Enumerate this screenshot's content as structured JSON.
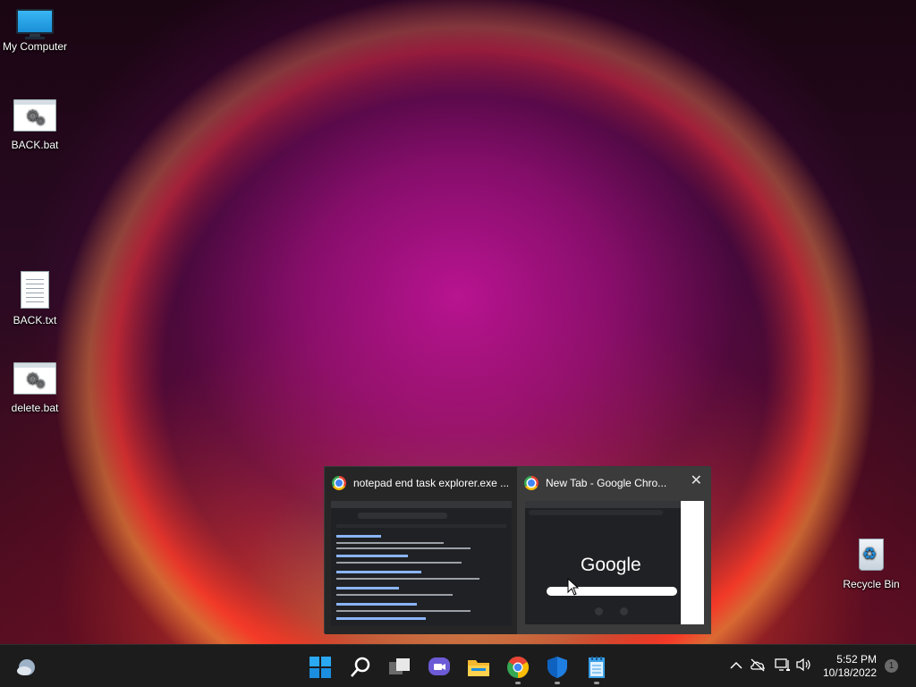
{
  "desktop": {
    "icons": [
      {
        "label": "My Computer"
      },
      {
        "label": "BACK.bat"
      },
      {
        "label": "BACK.txt"
      },
      {
        "label": "delete.bat"
      },
      {
        "label": "Recycle Bin"
      }
    ]
  },
  "preview": {
    "windows": [
      {
        "title": "notepad end task explorer.exe ...",
        "icon": "chrome-icon"
      },
      {
        "title": "New Tab - Google Chro...",
        "icon": "chrome-icon",
        "close_label": "✕",
        "thumb_logo": "Google"
      }
    ]
  },
  "taskbar": {
    "icons": [
      "weather-icon",
      "start-icon",
      "search-icon",
      "task-view-icon",
      "chat-icon",
      "file-explorer-icon",
      "chrome-icon",
      "defender-icon",
      "notepad-icon"
    ],
    "tray": {
      "chevron": "^",
      "time": "5:52 PM",
      "date": "10/18/2022",
      "notification_count": "1"
    }
  },
  "colors": {
    "taskbar_bg": "#1c1c1c",
    "accent": "#0078d4",
    "preview_bg": "#2b2b2b"
  }
}
